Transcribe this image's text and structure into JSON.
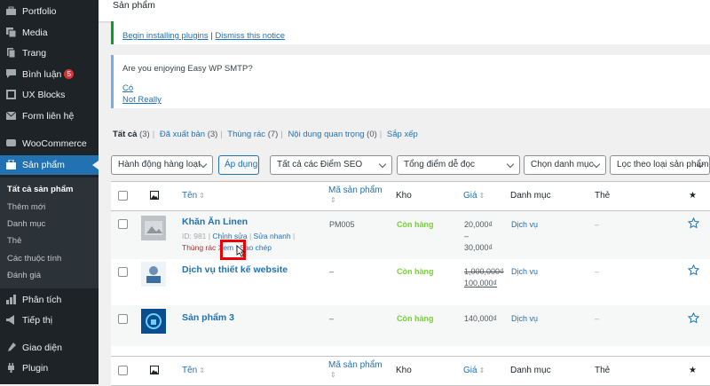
{
  "sidebar": {
    "items": [
      {
        "label": "Portfolio",
        "icon": "portfolio-icon"
      },
      {
        "label": "Media",
        "icon": "media-icon"
      },
      {
        "label": "Trang",
        "icon": "pages-icon"
      },
      {
        "label": "Bình luận",
        "icon": "comments-icon",
        "badge": "5"
      },
      {
        "label": "UX Blocks",
        "icon": "blocks-icon"
      },
      {
        "label": "Form liên hệ",
        "icon": "mail-icon"
      },
      {
        "label": "WooCommerce",
        "icon": "woocommerce-icon"
      },
      {
        "label": "Sản phẩm",
        "icon": "products-icon"
      },
      {
        "label": "Phân tích",
        "icon": "analytics-icon"
      },
      {
        "label": "Tiếp thị",
        "icon": "marketing-icon"
      },
      {
        "label": "Giao diện",
        "icon": "appearance-icon"
      },
      {
        "label": "Plugin",
        "icon": "plugins-icon"
      }
    ],
    "submenu": [
      "Tất cả sản phẩm",
      "Thêm mới",
      "Danh mục",
      "Thẻ",
      "Các thuộc tính",
      "Đánh giá"
    ]
  },
  "header": {
    "title": "Sản phẩm"
  },
  "notices": {
    "plugins": {
      "install_link": "Begin installing plugins",
      "separator": "|",
      "dismiss_link": "Dismiss this notice"
    },
    "smtp": {
      "message": "Are you enjoying Easy WP SMTP?",
      "yes": "Có",
      "no": "Not Really"
    }
  },
  "views": [
    {
      "label": "Tất cả",
      "count": "(3)"
    },
    {
      "label": "Đã xuất bản",
      "count": "(3)"
    },
    {
      "label": "Thùng rác",
      "count": "(7)"
    },
    {
      "label": "Nội dung quan trọng",
      "count": "(0)"
    },
    {
      "label": "Sắp xếp",
      "count": ""
    }
  ],
  "filters": {
    "bulk_action": "Hành động hàng loạt",
    "apply": "Áp dụng",
    "seo": "Tất cả các Điểm SEO",
    "readability": "Tổng điểm dễ đọc",
    "category": "Chọn danh mục",
    "type": "Lọc theo loại sản phẩm"
  },
  "columns": {
    "name": "Tên",
    "sku": "Mã sản phẩm",
    "stock": "Kho",
    "price": "Giá",
    "categories": "Danh mục",
    "tags": "Thẻ"
  },
  "products": [
    {
      "name": "Khăn Ăn Linen",
      "id_text": "ID: 981",
      "edit": "Chỉnh sửa",
      "quick_edit": "Sửa nhanh",
      "trash": "Thùng rác",
      "view": "Xem",
      "duplicate": "Sao chép",
      "sku": "PM005",
      "stock": "Còn hàng",
      "price_low": "20,000₫",
      "price_dash": "–",
      "price_high": "30,000₫",
      "category": "Dịch vụ",
      "tags": "–"
    },
    {
      "name": "Dịch vụ thiết kế website",
      "sku": "–",
      "stock": "Còn hàng",
      "price_old": "1,000,000₫",
      "price_new": "100,000₫",
      "category": "Dịch vụ",
      "tags": "–"
    },
    {
      "name": "Sản phẩm 3",
      "sku": "–",
      "stock": "Còn hàng",
      "price": "140,000₫",
      "category": "Dịch vụ",
      "tags": "–"
    }
  ],
  "colors": {
    "sidebar": "#1d2327",
    "accent": "#2271b1",
    "in_stock": "#7ad03a",
    "highlight": "#ee0000"
  }
}
